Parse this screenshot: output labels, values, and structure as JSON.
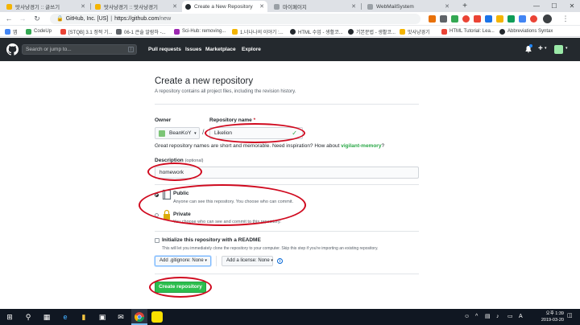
{
  "browser": {
    "tabs": [
      {
        "title": "맛사냥경기 :: 글쓰기",
        "fav_color": "#f4b400"
      },
      {
        "title": "맛사냥경기 :: 맛사냥경기",
        "fav_color": "#f4b400"
      },
      {
        "title": "Create a New Repository",
        "fav_color": "#24292e"
      },
      {
        "title": "마이페이지",
        "fav_color": "#9aa0a6"
      },
      {
        "title": "WebMailSystem",
        "fav_color": "#9aa0a6"
      }
    ],
    "new_tab": "+",
    "window_controls": {
      "minimize": "—",
      "maximize": "☐",
      "close": "✕"
    },
    "nav": {
      "back": "←",
      "forward": "→",
      "reload": "↻"
    },
    "address": {
      "org": "GitHub, Inc. [US]",
      "separator": "|",
      "host": "https://github.com",
      "path": "/new"
    },
    "bookmarks": [
      {
        "label": "앱",
        "color": "#4285f4"
      },
      {
        "label": "CodeUp",
        "color": "#34a853"
      },
      {
        "label": "[STQB] 3.1 정적 기...",
        "color": "#ea4335"
      },
      {
        "label": "06-1 큰술 알람하 -...",
        "color": "#5f6368"
      },
      {
        "label": "Sci-Hub: removing...",
        "color": "#9c27b0"
      },
      {
        "label": "1.너나나의 이야기 :...",
        "color": "#f4b400"
      },
      {
        "label": "HTML 수업 - 생활코...",
        "color": "#24292e"
      },
      {
        "label": "기본문법 - 생활코...",
        "color": "#24292e"
      },
      {
        "label": "맛사냥경기",
        "color": "#f4b400"
      },
      {
        "label": "HTML Tutorial: Lea...",
        "color": "#ea4335"
      },
      {
        "label": "Abbreviations Syntax",
        "color": "#24292e"
      }
    ]
  },
  "github": {
    "search_placeholder": "Search or jump to...",
    "search_key": "/",
    "nav": [
      "Pull requests",
      "Issues",
      "Marketplace",
      "Explore"
    ],
    "plus": "+",
    "caret": "▾"
  },
  "form": {
    "title": "Create a new repository",
    "subtitle": "A repository contains all project files, including the revision history.",
    "owner_label": "Owner",
    "owner_value": "BeanKoY",
    "slash": "/",
    "repo_label": "Repository name",
    "required_mark": "*",
    "repo_value": "Likelion",
    "valid_mark": "✓",
    "hint_prefix": "Great repository names are short and memorable. Need inspiration? How about",
    "hint_suggestion": "vigilant-memory",
    "hint_suffix": "?",
    "desc_label": "Description",
    "desc_optional": "(optional)",
    "desc_value": "homework",
    "public_label": "Public",
    "public_desc": "Anyone can see this repository. You choose who can commit.",
    "private_label": "Private",
    "private_desc": "You choose who can see and commit to this repository.",
    "init_label": "Initialize this repository with a README",
    "init_desc": "This will let you immediately clone the repository to your computer. Skip this step if you're importing an existing repository.",
    "gitignore_label": "Add .gitignore: None",
    "license_label": "Add a license: None",
    "info": "i",
    "submit": "Create repository",
    "visibility": "public",
    "init_readme": false
  },
  "colors": {
    "accent": "#28a745",
    "annotation": "#d00a1f",
    "header": "#24292e",
    "suggestion": "#28a745"
  },
  "taskbar": {
    "start": "⊞",
    "search": "⚲",
    "clock_time": "오후 1:39",
    "clock_date": "2019-03-20",
    "lang": "A"
  }
}
